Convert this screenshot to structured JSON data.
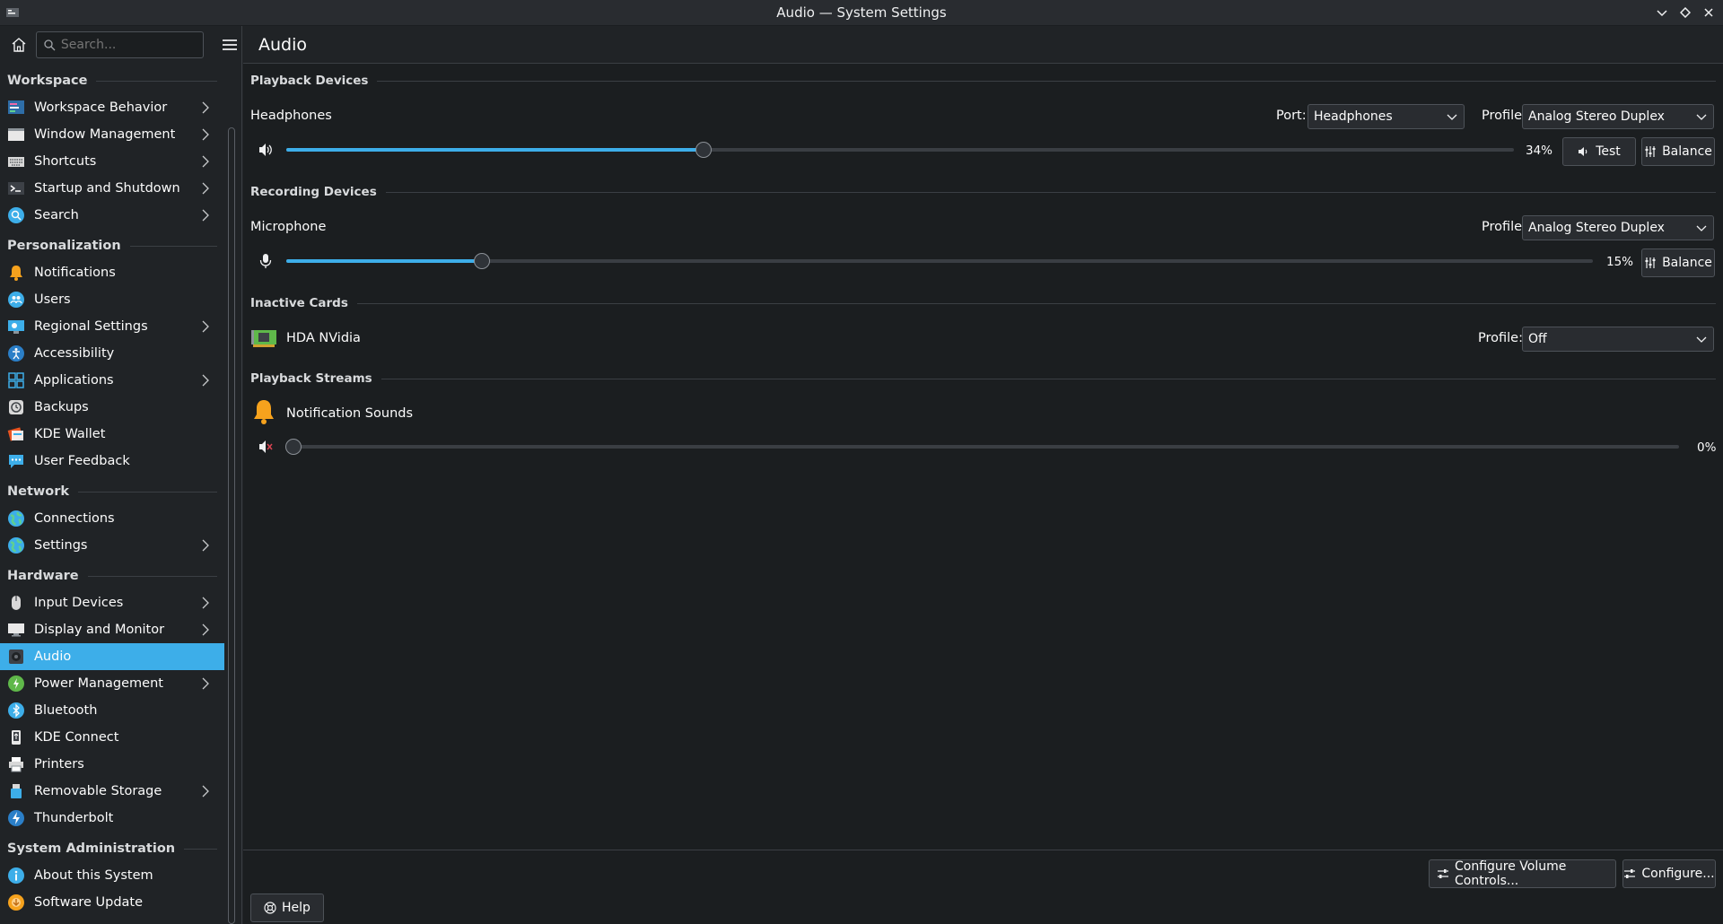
{
  "window": {
    "title": "Audio — System Settings"
  },
  "sidebar": {
    "search_placeholder": "Search...",
    "categories": {
      "workspace": "Workspace",
      "personalization": "Personalization",
      "network": "Network",
      "hardware": "Hardware",
      "sysadmin": "System Administration"
    },
    "items": {
      "workspace_behavior": "Workspace Behavior",
      "window_management": "Window Management",
      "shortcuts": "Shortcuts",
      "startup_shutdown": "Startup and Shutdown",
      "search": "Search",
      "notifications": "Notifications",
      "users": "Users",
      "regional": "Regional Settings",
      "accessibility": "Accessibility",
      "applications": "Applications",
      "backups": "Backups",
      "kde_wallet": "KDE Wallet",
      "user_feedback": "User Feedback",
      "connections": "Connections",
      "net_settings": "Settings",
      "input_devices": "Input Devices",
      "display": "Display and Monitor",
      "audio": "Audio",
      "power": "Power Management",
      "bluetooth": "Bluetooth",
      "kde_connect": "KDE Connect",
      "printers": "Printers",
      "removable": "Removable Storage",
      "thunderbolt": "Thunderbolt",
      "about": "About this System",
      "software_update": "Software Update"
    }
  },
  "page": {
    "title": "Audio",
    "playback_devices": {
      "heading": "Playback Devices",
      "device": "Headphones",
      "port_label": "Port:",
      "port_value": "Headphones",
      "profile_label": "Profile:",
      "profile_value": "Analog Stereo Duplex",
      "volume": 34,
      "volume_text": "34%",
      "test_label": "Test",
      "balance_label": "Balance"
    },
    "recording_devices": {
      "heading": "Recording Devices",
      "device": "Microphone",
      "profile_label": "Profile:",
      "profile_value": "Analog Stereo Duplex",
      "volume": 15,
      "volume_text": "15%",
      "balance_label": "Balance"
    },
    "inactive_cards": {
      "heading": "Inactive Cards",
      "card": "HDA NVidia",
      "profile_label": "Profile:",
      "profile_value": "Off"
    },
    "playback_streams": {
      "heading": "Playback Streams",
      "stream": "Notification Sounds",
      "volume": 0,
      "volume_text": "0%"
    },
    "footer": {
      "configure_volume": "Configure Volume Controls...",
      "configure": "Configure...",
      "help": "Help"
    }
  },
  "colors": {
    "accent": "#3daee9",
    "background": "#1b1e20",
    "sidebar": "#202326"
  }
}
